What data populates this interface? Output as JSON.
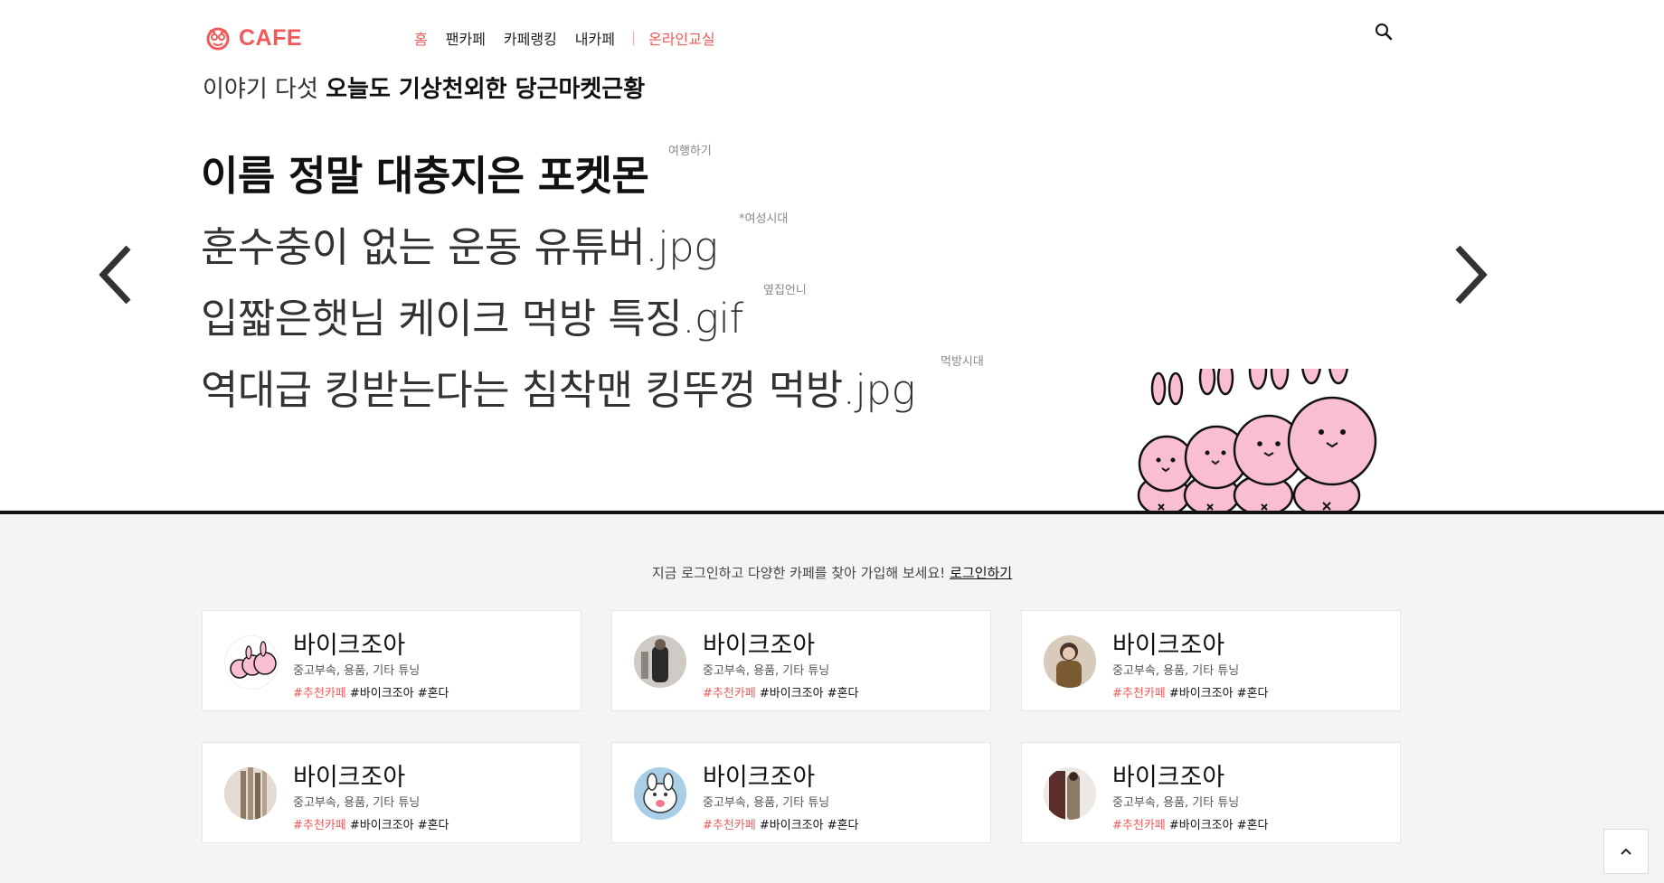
{
  "header": {
    "logo_text": "CAFE",
    "nav": [
      {
        "label": "홈",
        "active": true
      },
      {
        "label": "팬카페"
      },
      {
        "label": "카페랭킹"
      },
      {
        "label": "내카페"
      },
      {
        "label": "온라인교실",
        "accent": true
      }
    ]
  },
  "hero": {
    "heading_prefix": "이야기 다섯",
    "heading_bold": "오늘도 기상천외한 당근마켓근황",
    "stories": [
      {
        "title": "이름 정말 대충지은 포켓몬",
        "tag": "여행하기"
      },
      {
        "title": "훈수충이 없는 운동 유튜버.jpg",
        "tag": "*여성시대"
      },
      {
        "title": "입짧은햇님 케이크 먹방 특징.gif",
        "tag": "옆집언니"
      },
      {
        "title": "역대급 킹받는다는 침착맨 킹뚜껑 먹방.jpg",
        "tag": "먹방시대"
      }
    ]
  },
  "login_prompt": {
    "text": "지금 로그인하고 다양한 카페를 찾아 가입해 보세요!",
    "link": "로그인하기"
  },
  "cafes": [
    {
      "name": "바이크조아",
      "desc": "중고부속, 용품, 기타 튜닝",
      "tag_hot": "#추천카페",
      "tags": "#바이크조아 #혼다",
      "avatar": "bunnies"
    },
    {
      "name": "바이크조아",
      "desc": "중고부속, 용품, 기타 튜닝",
      "tag_hot": "#추천카페",
      "tags": "#바이크조아 #혼다",
      "avatar": "person-dark"
    },
    {
      "name": "바이크조아",
      "desc": "중고부속, 용품, 기타 튜닝",
      "tag_hot": "#추천카페",
      "tags": "#바이크조아 #혼다",
      "avatar": "person-brown"
    },
    {
      "name": "바이크조아",
      "desc": "중고부속, 용품, 기타 튜닝",
      "tag_hot": "#추천카페",
      "tags": "#바이크조아 #혼다",
      "avatar": "curtain"
    },
    {
      "name": "바이크조아",
      "desc": "중고부속, 용품, 기타 튜닝",
      "tag_hot": "#추천카페",
      "tags": "#바이크조아 #혼다",
      "avatar": "cartoon-face"
    },
    {
      "name": "바이크조아",
      "desc": "중고부속, 용품, 기타 튜닝",
      "tag_hot": "#추천카페",
      "tags": "#바이크조아 #혼다",
      "avatar": "person-mirror"
    }
  ],
  "colors": {
    "brand": "#f25a5a",
    "lower_bg": "#f4f4f4",
    "mascot_pink": "#f9bfd0"
  },
  "icons": {
    "search": "search-icon",
    "prev": "chevron-left-icon",
    "next": "chevron-right-icon",
    "top": "chevron-up-icon"
  }
}
